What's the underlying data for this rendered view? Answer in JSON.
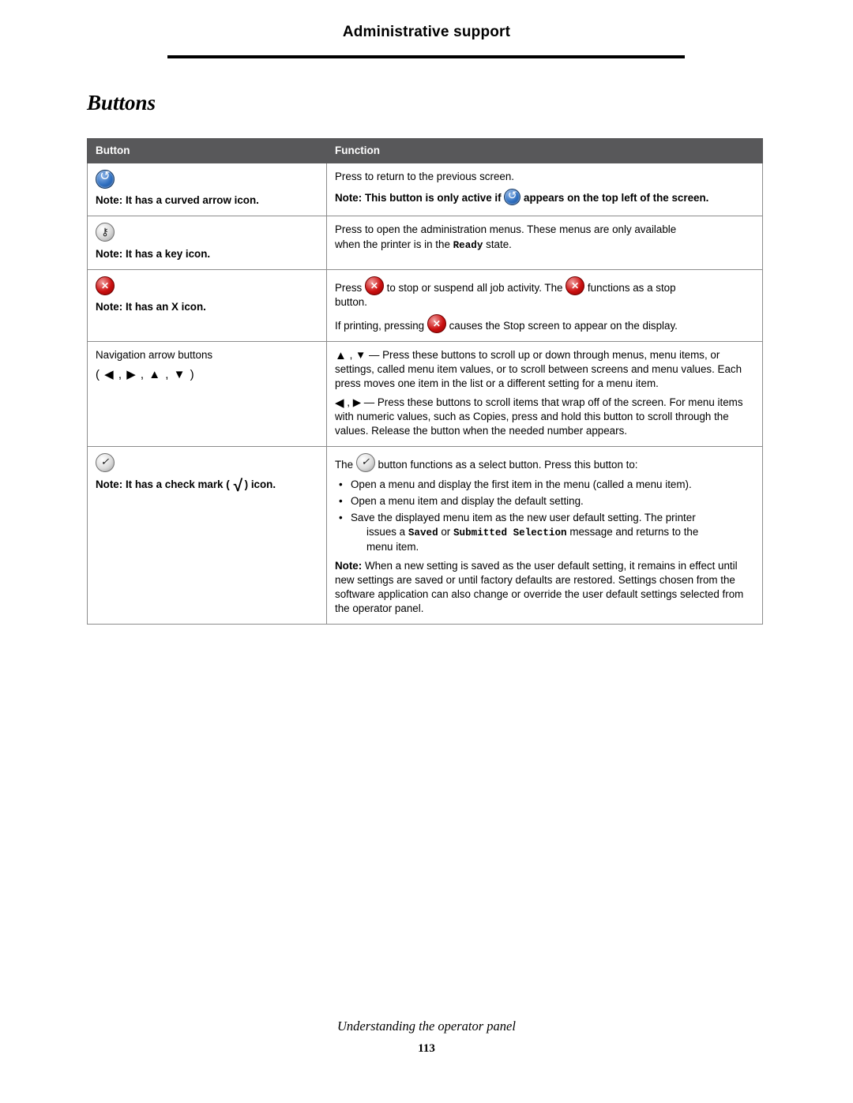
{
  "header": {
    "title": "Administrative support"
  },
  "section": {
    "heading": "Buttons"
  },
  "table": {
    "columns": [
      "Button",
      "Function"
    ],
    "rows": [
      {
        "button_icon": "back-arrow-icon",
        "button_note_label": "Note:",
        "button_note_text": " It has a curved arrow icon.",
        "function_line1": "Press to return to the previous screen.",
        "function_note_label": "Note:",
        "function_note_part1": " This button is only active if ",
        "function_note_part2": " appears on the top left of the screen."
      },
      {
        "button_icon": "key-icon",
        "button_note_label": "Note:",
        "button_note_text": " It has a key icon.",
        "function_line1": "Press to open the administration menus. These menus are only available",
        "function_line2_pre": "when the printer is in the ",
        "function_line2_mono": "Ready",
        "function_line2_post": " state."
      },
      {
        "button_icon": "stop-x-icon",
        "button_note_label": "Note:",
        "button_note_text": " It has an X icon.",
        "function_p1_a": "Press ",
        "function_p1_b": " to stop or suspend all job activity. The ",
        "function_p1_c": " functions as a stop",
        "function_p1_d": "button.",
        "function_p2_a": "If printing, pressing ",
        "function_p2_b": " causes the Stop screen to appear on the display."
      },
      {
        "button_label": "Navigation arrow buttons",
        "button_symbols": "( ◀ , ▶ , ▲ , ▼ )",
        "function_p1": " , ▼ — Press these buttons to scroll up or down through menus, menu items, or settings, called menu item values, or to scroll between screens and menu values. Each press moves one item in the list or a different setting for a menu item.",
        "function_p1_lead": "▲",
        "function_p2_lead": "◀",
        "function_p2": " , ▶ — Press these buttons to scroll items that wrap off of the screen. For menu items with numeric values, such as Copies, press and hold this button to scroll through the values. Release the button when the needed number appears."
      },
      {
        "button_icon": "select-check-icon",
        "button_note_label": "Note:",
        "button_note_pre": " It has a check mark ( ",
        "button_note_check": "√",
        "button_note_post": " ) icon.",
        "function_intro_pre": "The ",
        "function_intro_post": " button functions as a select button. Press this button to:",
        "bullets": [
          "Open a menu and display the first item in the menu (called a menu item).",
          "Open a menu item and display the default setting.",
          "Save the displayed menu item as the new user default setting. The printer"
        ],
        "bullet3_cont_pre": "issues a ",
        "bullet3_cont_mono1": "Saved",
        "bullet3_cont_mid": " or ",
        "bullet3_cont_mono2": "Submitted Selection",
        "bullet3_cont_post": " message and returns to the",
        "bullet3_cont_last": "menu item.",
        "function_note_label": "Note:",
        "function_note_text": " When a new setting is saved as the user default setting, it remains in effect until new settings are saved or until factory defaults are restored. Settings chosen from the software application can also change or override the user default settings selected from the operator panel."
      }
    ]
  },
  "footer": {
    "text": "Understanding the operator panel",
    "page_number": "113"
  }
}
